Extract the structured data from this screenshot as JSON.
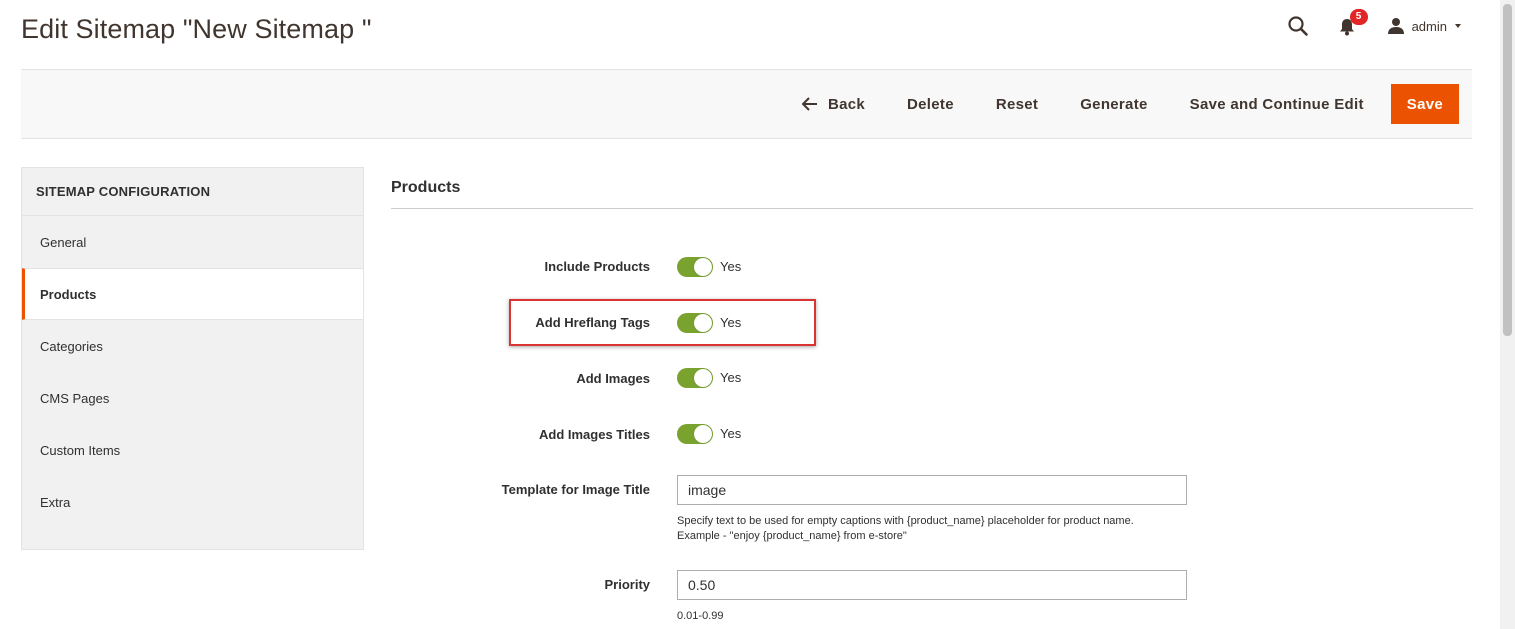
{
  "header": {
    "title": "Edit Sitemap \"New Sitemap \"",
    "notifications_count": "5",
    "user_name": "admin",
    "icons": [
      "search-icon",
      "bell-icon",
      "user-icon",
      "caret-down-icon"
    ]
  },
  "toolbar": {
    "back_label": "Back",
    "delete_label": "Delete",
    "reset_label": "Reset",
    "generate_label": "Generate",
    "save_continue_label": "Save and Continue Edit",
    "save_label": "Save"
  },
  "sidebar": {
    "heading": "SITEMAP CONFIGURATION",
    "items": [
      {
        "label": "General"
      },
      {
        "label": "Products"
      },
      {
        "label": "Categories"
      },
      {
        "label": "CMS Pages"
      },
      {
        "label": "Custom Items"
      },
      {
        "label": "Extra"
      }
    ],
    "active": "Products"
  },
  "section": {
    "title": "Products",
    "include_products": {
      "label": "Include Products",
      "value": "Yes"
    },
    "add_hreflang": {
      "label": "Add Hreflang Tags",
      "value": "Yes"
    },
    "add_images": {
      "label": "Add Images",
      "value": "Yes"
    },
    "add_images_titles": {
      "label": "Add Images Titles",
      "value": "Yes"
    },
    "image_title_template": {
      "label": "Template for Image Title",
      "value": "image",
      "note_line1": "Specify text to be used for empty captions with {product_name} placeholder for product name.",
      "note_line2": "Example - \"enjoy {product_name} from e-store\""
    },
    "priority": {
      "label": "Priority",
      "value": "0.50",
      "note": "0.01-0.99"
    }
  },
  "colors": {
    "accent": "#eb5202",
    "toggle_on": "#79a22e",
    "badge": "#e22626",
    "highlight": "#d93333"
  }
}
